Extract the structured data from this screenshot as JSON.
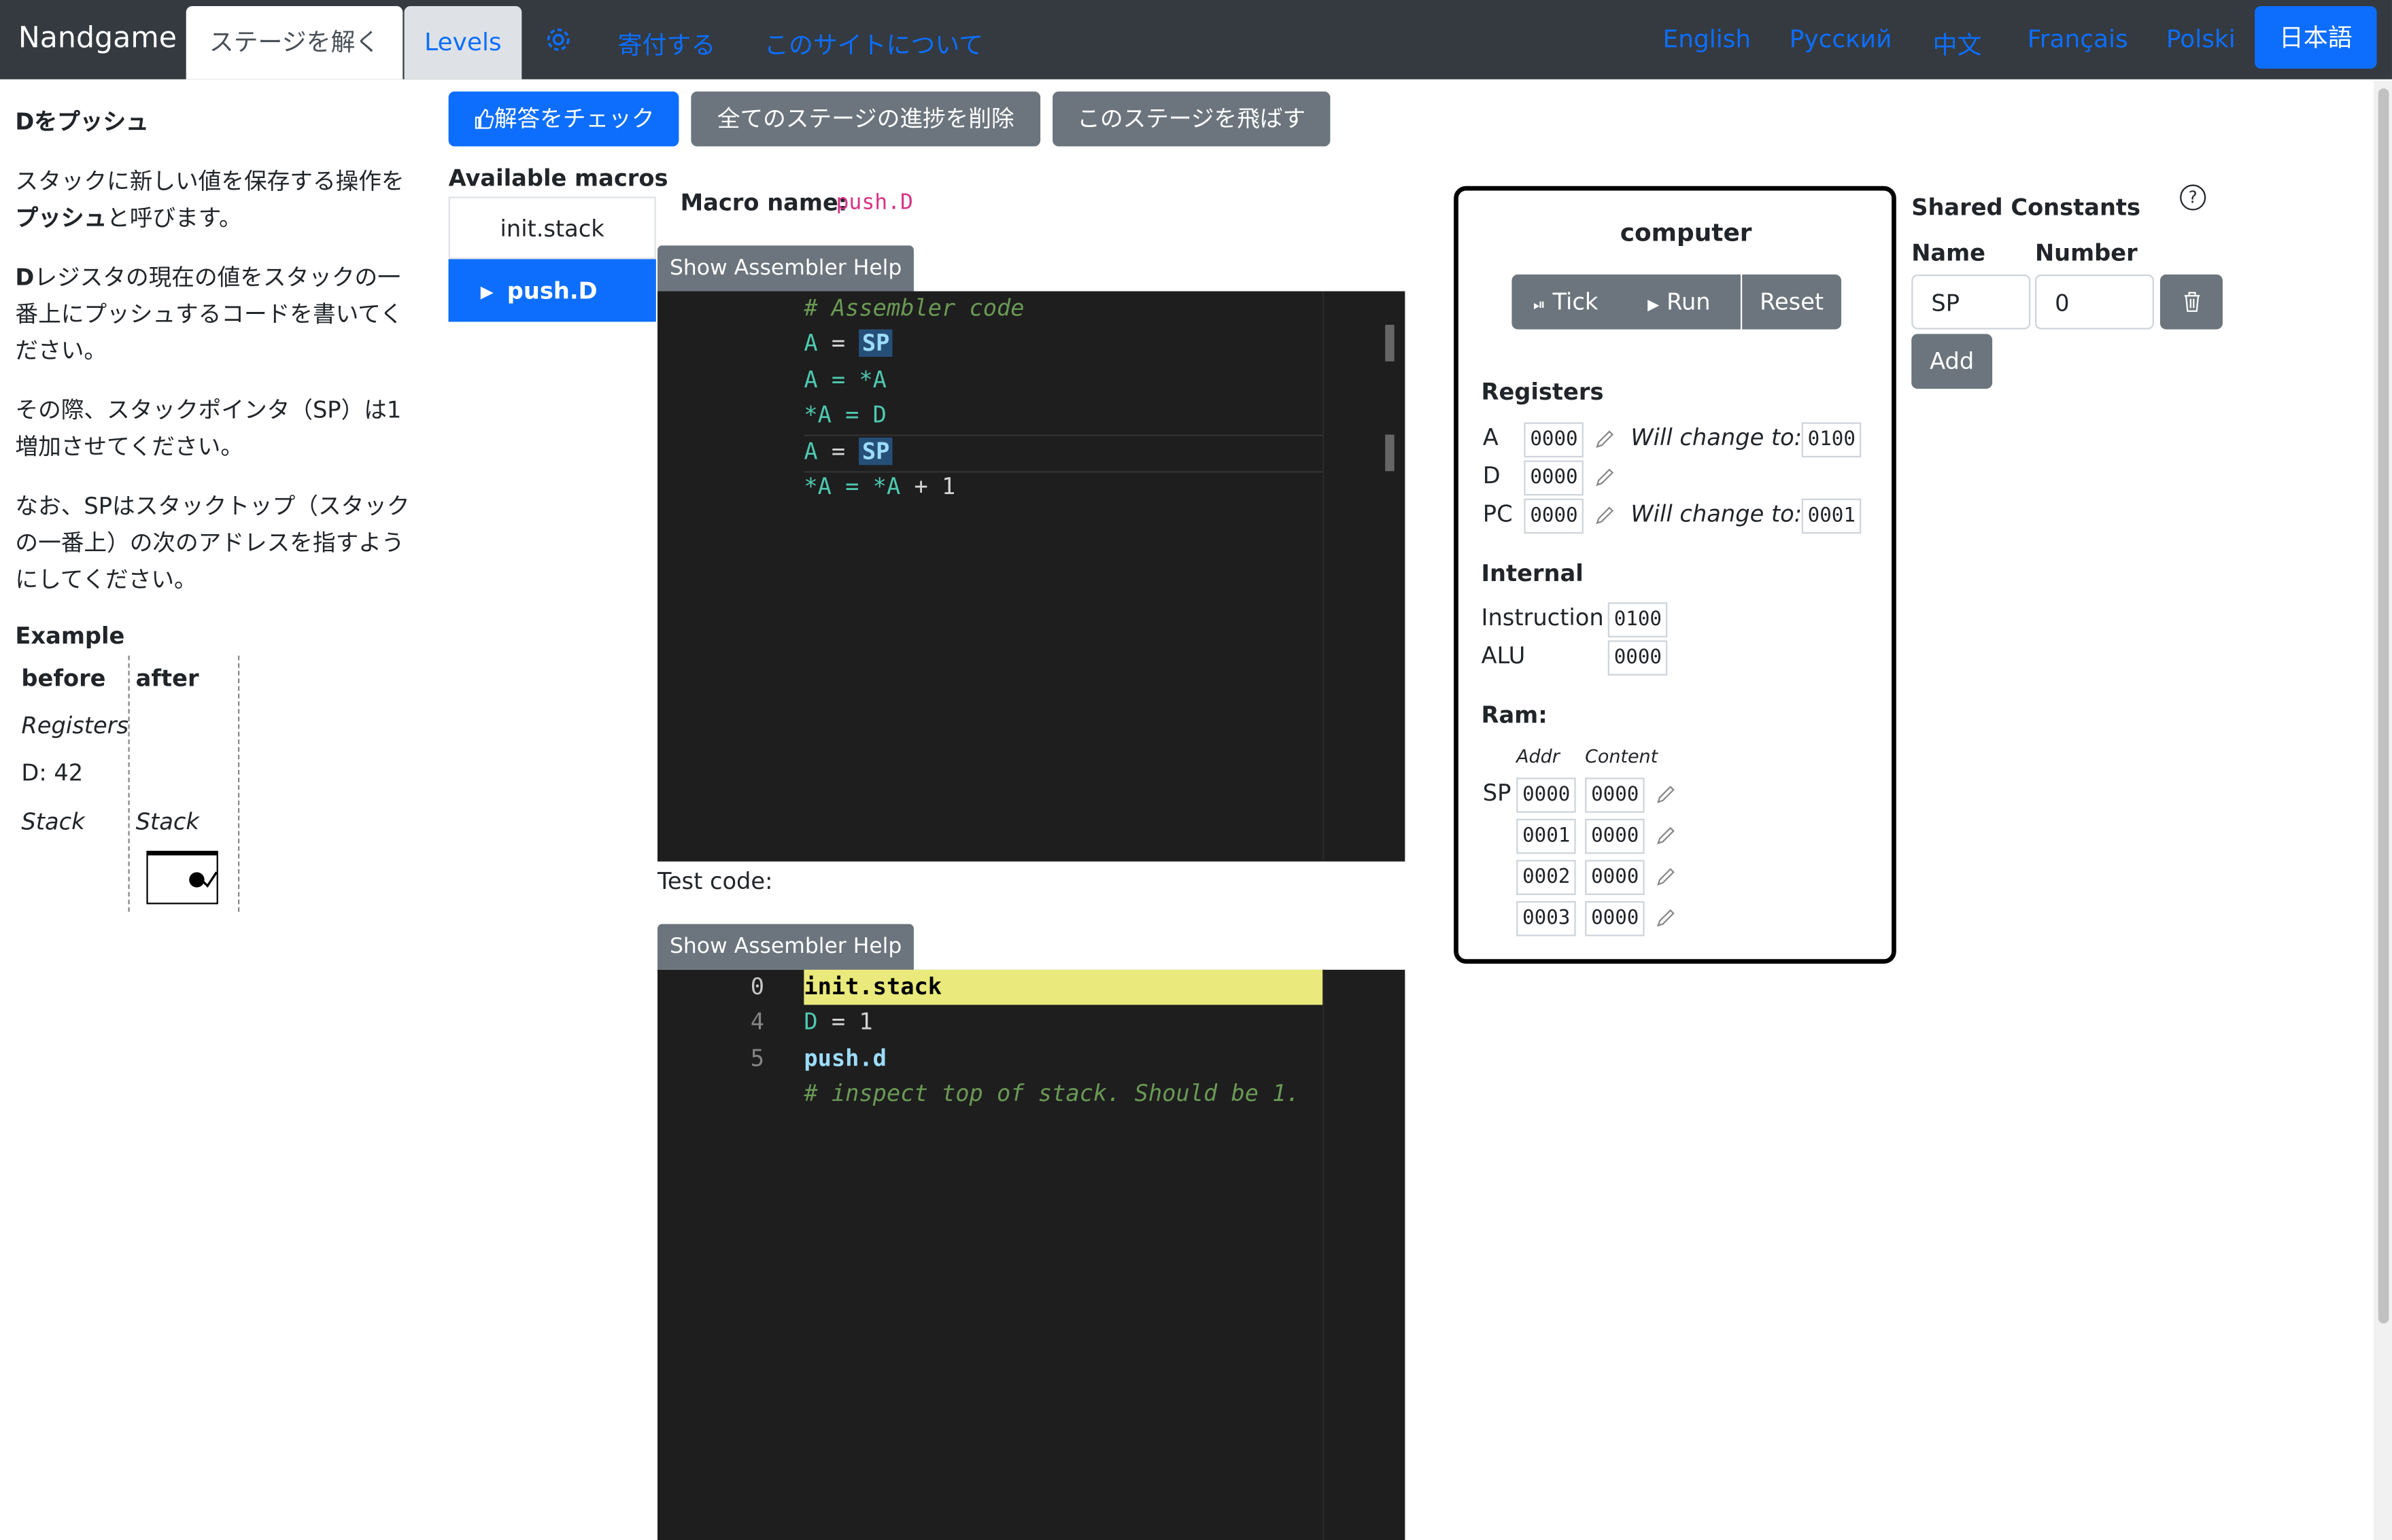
{
  "nav": {
    "brand": "Nandgame",
    "tab_solve": "ステージを解く",
    "tab_levels": "Levels",
    "donate": "寄付する",
    "about": "このサイトについて",
    "languages": [
      "English",
      "Русский",
      "中文",
      "Français",
      "Polski"
    ],
    "active_language": "日本語"
  },
  "task": {
    "title": "Dをプッシュ",
    "p1_a": "スタックに新しい値を保存する操作を",
    "p1_bold": "プッシュ",
    "p1_b": "と呼びます。",
    "p2_bold": "D",
    "p2_a": "レジスタの現在の値をスタックの一",
    "p2_b": "番上にプッシュするコードを書いてく",
    "p2_c": "ださい。",
    "p3_a": "その際、スタックポインタ（SP）は1",
    "p3_b": "増加させてください。",
    "p4_a": "なお、SPはスタックトップ（スタック",
    "p4_b": "の一番上）の次のアドレスを指すよう",
    "p4_c": "にしてください。",
    "example_title": "Example",
    "col_before": "before",
    "col_after": "after",
    "row_registers": "Registers",
    "d_value": "D: 42",
    "row_stack": "Stack",
    "row_stack_after": "Stack"
  },
  "toolbar": {
    "check": "解答をチェック",
    "reset_all": "全てのステージの進捗を削除",
    "skip": "このステージを飛ばす"
  },
  "macros": {
    "title": "Available macros",
    "items": [
      "init.stack",
      "push.D"
    ],
    "macro_name_label": "Macro name:",
    "macro_name_value": "push.D"
  },
  "editor": {
    "help_label": "Show Assembler Help",
    "comment": "# Assembler code",
    "line1_a": "A",
    "line1_sp": "SP",
    "line2": "A = *A",
    "line3": "*A = D",
    "line4_a": "A",
    "line4_sp": "SP",
    "line5_a": "*A = *A",
    "line5_b": "+ 1",
    "eq": "="
  },
  "test": {
    "label": "Test code:",
    "help_label": "Show Assembler Help",
    "line_numbers": [
      "0",
      "4",
      "5"
    ],
    "l1": "init.stack",
    "l2_a": "D",
    "l2_b": "= 1",
    "l3": "push.d",
    "l4": "# inspect top of stack. Should be 1."
  },
  "computer": {
    "title": "computer",
    "tick": "Tick",
    "run": "Run",
    "reset": "Reset",
    "registers_title": "Registers",
    "reg_a": "A",
    "reg_a_val": "0000",
    "reg_a_next": "0100",
    "reg_d": "D",
    "reg_d_val": "0000",
    "reg_pc": "PC",
    "reg_pc_val": "0000",
    "reg_pc_next": "0001",
    "will_change": "Will change to:",
    "internal_title": "Internal",
    "instruction": "Instruction",
    "instruction_val": "0100",
    "alu": "ALU",
    "alu_val": "0000",
    "ram_title": "Ram:",
    "addr_header": "Addr",
    "content_header": "Content",
    "sp_label": "SP",
    "ram": [
      {
        "addr": "0000",
        "content": "0000"
      },
      {
        "addr": "0001",
        "content": "0000"
      },
      {
        "addr": "0002",
        "content": "0000"
      },
      {
        "addr": "0003",
        "content": "0000"
      }
    ]
  },
  "constants": {
    "title": "Shared Constants",
    "help": "?",
    "name_header": "Name",
    "number_header": "Number",
    "name_value": "SP",
    "number_value": "0",
    "add": "Add"
  },
  "colors": {
    "nav_bg": "#343a40",
    "primary": "#0d6efd",
    "secondary": "#6c757d",
    "editor_bg": "#1e1e1e",
    "highlight": "#eaea7c"
  }
}
